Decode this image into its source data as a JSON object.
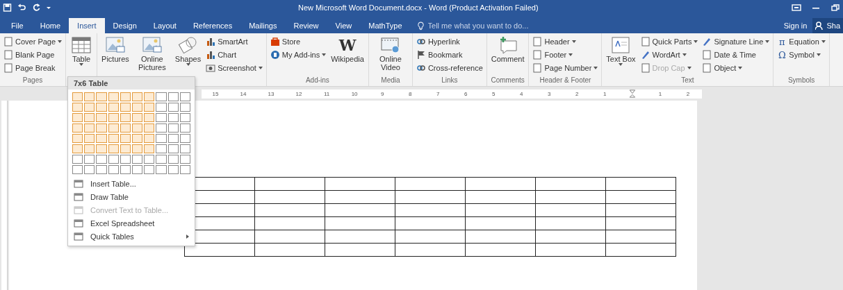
{
  "window": {
    "title": "New Microsoft Word Document.docx - Word (Product Activation Failed)"
  },
  "tabs": [
    {
      "label": "File",
      "selected": false
    },
    {
      "label": "Home",
      "selected": false
    },
    {
      "label": "Insert",
      "selected": true
    },
    {
      "label": "Design",
      "selected": false
    },
    {
      "label": "Layout",
      "selected": false
    },
    {
      "label": "References",
      "selected": false
    },
    {
      "label": "Mailings",
      "selected": false
    },
    {
      "label": "Review",
      "selected": false
    },
    {
      "label": "View",
      "selected": false
    },
    {
      "label": "MathType",
      "selected": false
    }
  ],
  "tell_me": {
    "placeholder": "Tell me what you want to do..."
  },
  "account": {
    "sign_in": "Sign in",
    "share": "Sha"
  },
  "ribbon": {
    "groups": [
      {
        "label": "Pages",
        "items": [
          {
            "label": "Cover Page",
            "kind": "small",
            "dropdown": true,
            "disabled": false
          },
          {
            "label": "Blank Page",
            "kind": "small",
            "dropdown": false,
            "disabled": false
          },
          {
            "label": "Page Break",
            "kind": "small",
            "dropdown": false,
            "disabled": false
          }
        ]
      },
      {
        "items": [
          {
            "label": "Table",
            "kind": "large",
            "dropdown": true,
            "disabled": false
          }
        ]
      },
      {
        "items": [
          {
            "label": "Pictures",
            "kind": "large",
            "dropdown": false,
            "disabled": false
          },
          {
            "label": "Online Pictures",
            "kind": "large",
            "dropdown": false,
            "disabled": false
          },
          {
            "label": "Shapes",
            "kind": "large",
            "dropdown": true,
            "disabled": false
          },
          {
            "label": "SmartArt",
            "kind": "small",
            "dropdown": false,
            "disabled": false
          },
          {
            "label": "Chart",
            "kind": "small",
            "dropdown": false,
            "disabled": false
          },
          {
            "label": "Screenshot",
            "kind": "small",
            "dropdown": true,
            "disabled": false
          }
        ]
      },
      {
        "label": "Add-ins",
        "items": [
          {
            "label": "Store",
            "kind": "small",
            "dropdown": false,
            "disabled": false
          },
          {
            "label": "My Add-ins",
            "kind": "small",
            "dropdown": true,
            "disabled": false
          },
          {
            "label": "Wikipedia",
            "kind": "large",
            "dropdown": false,
            "disabled": false,
            "glyph": "W"
          }
        ]
      },
      {
        "label": "Media",
        "items": [
          {
            "label": "Online Video",
            "kind": "large",
            "dropdown": false,
            "disabled": false
          }
        ]
      },
      {
        "label": "Links",
        "items": [
          {
            "label": "Hyperlink",
            "kind": "small",
            "dropdown": false,
            "disabled": false
          },
          {
            "label": "Bookmark",
            "kind": "small",
            "dropdown": false,
            "disabled": false
          },
          {
            "label": "Cross-reference",
            "kind": "small",
            "dropdown": false,
            "disabled": false
          }
        ]
      },
      {
        "label": "Comments",
        "items": [
          {
            "label": "Comment",
            "kind": "large",
            "dropdown": false,
            "disabled": false
          }
        ]
      },
      {
        "label": "Header & Footer",
        "items": [
          {
            "label": "Header",
            "kind": "small",
            "dropdown": true,
            "disabled": false
          },
          {
            "label": "Footer",
            "kind": "small",
            "dropdown": true,
            "disabled": false
          },
          {
            "label": "Page Number",
            "kind": "small",
            "dropdown": true,
            "disabled": false
          }
        ]
      },
      {
        "label": "Text",
        "items": [
          {
            "label": "Text Box",
            "kind": "large",
            "dropdown": true,
            "disabled": false
          },
          {
            "label": "Quick Parts",
            "kind": "small",
            "dropdown": true,
            "disabled": false
          },
          {
            "label": "WordArt",
            "kind": "small",
            "dropdown": true,
            "disabled": false
          },
          {
            "label": "Drop Cap",
            "kind": "small",
            "dropdown": true,
            "disabled": true
          },
          {
            "label": "Signature Line",
            "kind": "small",
            "dropdown": true,
            "disabled": false
          },
          {
            "label": "Date & Time",
            "kind": "small",
            "dropdown": false,
            "disabled": false
          },
          {
            "label": "Object",
            "kind": "small",
            "dropdown": true,
            "disabled": false
          }
        ]
      },
      {
        "label": "Symbols",
        "items": [
          {
            "label": "Equation",
            "kind": "small",
            "dropdown": true,
            "disabled": false,
            "glyph": "π"
          },
          {
            "label": "Symbol",
            "kind": "small",
            "dropdown": true,
            "disabled": false,
            "glyph": "Ω"
          }
        ]
      }
    ]
  },
  "table_menu": {
    "title": "7x6 Table",
    "grid": [
      {
        "cells": [
          {
            "selected": true
          },
          {
            "selected": true
          },
          {
            "selected": true
          },
          {
            "selected": true
          },
          {
            "selected": true
          },
          {
            "selected": true
          },
          {
            "selected": true
          },
          {
            "selected": false
          },
          {
            "selected": false
          },
          {
            "selected": false
          }
        ]
      },
      {
        "cells": [
          {
            "selected": true
          },
          {
            "selected": true
          },
          {
            "selected": true
          },
          {
            "selected": true
          },
          {
            "selected": true
          },
          {
            "selected": true
          },
          {
            "selected": true
          },
          {
            "selected": false
          },
          {
            "selected": false
          },
          {
            "selected": false
          }
        ]
      },
      {
        "cells": [
          {
            "selected": true
          },
          {
            "selected": true
          },
          {
            "selected": true
          },
          {
            "selected": true
          },
          {
            "selected": true
          },
          {
            "selected": true
          },
          {
            "selected": true
          },
          {
            "selected": false
          },
          {
            "selected": false
          },
          {
            "selected": false
          }
        ]
      },
      {
        "cells": [
          {
            "selected": true
          },
          {
            "selected": true
          },
          {
            "selected": true
          },
          {
            "selected": true
          },
          {
            "selected": true
          },
          {
            "selected": true
          },
          {
            "selected": true
          },
          {
            "selected": false
          },
          {
            "selected": false
          },
          {
            "selected": false
          }
        ]
      },
      {
        "cells": [
          {
            "selected": true
          },
          {
            "selected": true
          },
          {
            "selected": true
          },
          {
            "selected": true
          },
          {
            "selected": true
          },
          {
            "selected": true
          },
          {
            "selected": true
          },
          {
            "selected": false
          },
          {
            "selected": false
          },
          {
            "selected": false
          }
        ]
      },
      {
        "cells": [
          {
            "selected": true
          },
          {
            "selected": true
          },
          {
            "selected": true
          },
          {
            "selected": true
          },
          {
            "selected": true
          },
          {
            "selected": true
          },
          {
            "selected": true
          },
          {
            "selected": false
          },
          {
            "selected": false
          },
          {
            "selected": false
          }
        ]
      },
      {
        "cells": [
          {
            "selected": false
          },
          {
            "selected": false
          },
          {
            "selected": false
          },
          {
            "selected": false
          },
          {
            "selected": false
          },
          {
            "selected": false
          },
          {
            "selected": false
          },
          {
            "selected": false
          },
          {
            "selected": false
          },
          {
            "selected": false
          }
        ]
      },
      {
        "cells": [
          {
            "selected": false
          },
          {
            "selected": false
          },
          {
            "selected": false
          },
          {
            "selected": false
          },
          {
            "selected": false
          },
          {
            "selected": false
          },
          {
            "selected": false
          },
          {
            "selected": false
          },
          {
            "selected": false
          },
          {
            "selected": false
          }
        ]
      }
    ],
    "items": [
      {
        "label": "Insert Table...",
        "disabled": false,
        "submenu": false
      },
      {
        "label": "Draw Table",
        "disabled": false,
        "submenu": false
      },
      {
        "label": "Convert Text to Table...",
        "disabled": true,
        "submenu": false
      },
      {
        "label": "Excel Spreadsheet",
        "disabled": false,
        "submenu": false
      },
      {
        "label": "Quick Tables",
        "disabled": false,
        "submenu": true
      }
    ]
  },
  "ruler": {
    "left_labels": [
      "15",
      "14",
      "13",
      "12",
      "11",
      "10",
      "9",
      "8",
      "7",
      "6",
      "5",
      "4",
      "3",
      "2",
      "1"
    ],
    "right_labels": [
      "1",
      "2"
    ]
  }
}
